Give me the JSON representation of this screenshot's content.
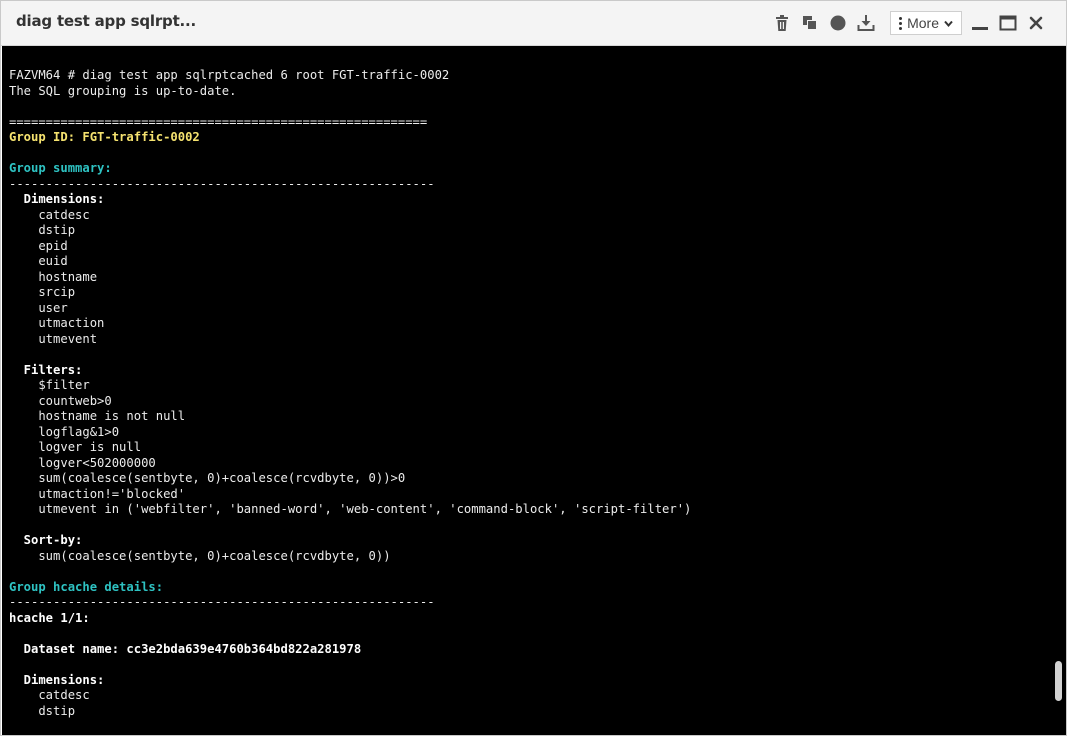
{
  "window": {
    "title": "diag test app sqlrpt...",
    "more_label": "More"
  },
  "icons": {
    "delete": "trash-icon",
    "copy": "copy-icon",
    "record": "record-icon",
    "download": "download-icon",
    "more": "kebab-menu-icon",
    "more_caret": "chevron-down-icon",
    "minimize": "minimize-icon",
    "maximize": "maximize-icon",
    "close": "close-icon"
  },
  "colors": {
    "terminal_bg": "#000000",
    "text": "#ececec",
    "group_id": "#f5e26f",
    "section_heading": "#2ec2c2"
  },
  "terminal": {
    "lines": [
      {
        "text": "FAZVM64 # diag test app sqlrptcached 6 root FGT-traffic-0002",
        "style": ""
      },
      {
        "text": "The SQL grouping is up-to-date.",
        "style": ""
      },
      {
        "text": "",
        "style": ""
      },
      {
        "text": "=========================================================",
        "style": ""
      },
      {
        "text": "Group ID: FGT-traffic-0002",
        "style": "yellow"
      },
      {
        "text": "",
        "style": ""
      },
      {
        "text": "Group summary:",
        "style": "cyan"
      },
      {
        "text": "----------------------------------------------------------",
        "style": ""
      },
      {
        "text": "  Dimensions:",
        "style": "bold"
      },
      {
        "text": "    catdesc",
        "style": ""
      },
      {
        "text": "    dstip",
        "style": ""
      },
      {
        "text": "    epid",
        "style": ""
      },
      {
        "text": "    euid",
        "style": ""
      },
      {
        "text": "    hostname",
        "style": ""
      },
      {
        "text": "    srcip",
        "style": ""
      },
      {
        "text": "    user",
        "style": ""
      },
      {
        "text": "    utmaction",
        "style": ""
      },
      {
        "text": "    utmevent",
        "style": ""
      },
      {
        "text": "",
        "style": ""
      },
      {
        "text": "  Filters:",
        "style": "bold"
      },
      {
        "text": "    $filter",
        "style": ""
      },
      {
        "text": "    countweb>0",
        "style": ""
      },
      {
        "text": "    hostname is not null",
        "style": ""
      },
      {
        "text": "    logflag&1>0",
        "style": ""
      },
      {
        "text": "    logver is null",
        "style": ""
      },
      {
        "text": "    logver<502000000",
        "style": ""
      },
      {
        "text": "    sum(coalesce(sentbyte, 0)+coalesce(rcvdbyte, 0))>0",
        "style": ""
      },
      {
        "text": "    utmaction!='blocked'",
        "style": ""
      },
      {
        "text": "    utmevent in ('webfilter', 'banned-word', 'web-content', 'command-block', 'script-filter')",
        "style": ""
      },
      {
        "text": "",
        "style": ""
      },
      {
        "text": "  Sort-by:",
        "style": "bold"
      },
      {
        "text": "    sum(coalesce(sentbyte, 0)+coalesce(rcvdbyte, 0))",
        "style": ""
      },
      {
        "text": "",
        "style": ""
      },
      {
        "text": "Group hcache details:",
        "style": "cyan"
      },
      {
        "text": "----------------------------------------------------------",
        "style": ""
      },
      {
        "text": "hcache 1/1:",
        "style": "bold"
      },
      {
        "text": "",
        "style": ""
      },
      {
        "text": "  Dataset name: cc3e2bda639e4760b364bd822a281978",
        "style": "bold"
      },
      {
        "text": "",
        "style": ""
      },
      {
        "text": "  Dimensions:",
        "style": "bold"
      },
      {
        "text": "    catdesc",
        "style": ""
      },
      {
        "text": "    dstip",
        "style": ""
      }
    ]
  }
}
